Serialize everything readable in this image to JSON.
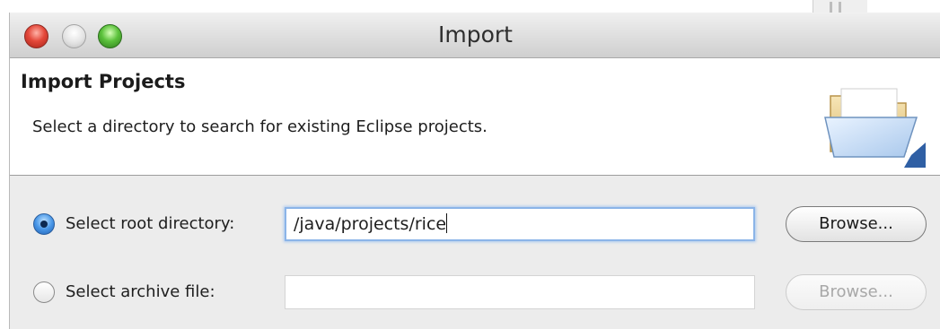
{
  "window": {
    "title": "Import"
  },
  "banner": {
    "title": "Import Projects",
    "description": "Select a directory to search for existing Eclipse projects.",
    "icon": "open-folder-icon"
  },
  "options": {
    "root_directory": {
      "label": "Select root directory:",
      "selected": true,
      "value": "/java/projects/rice",
      "browse_label": "Browse...",
      "browse_enabled": true
    },
    "archive_file": {
      "label": "Select archive file:",
      "selected": false,
      "value": "",
      "browse_label": "Browse...",
      "browse_enabled": false
    }
  },
  "colors": {
    "close_button": "#e4483a",
    "zoom_button": "#5cc23c",
    "radio_selected": "#4a98e8",
    "focus_ring": "#8bb4e8"
  }
}
